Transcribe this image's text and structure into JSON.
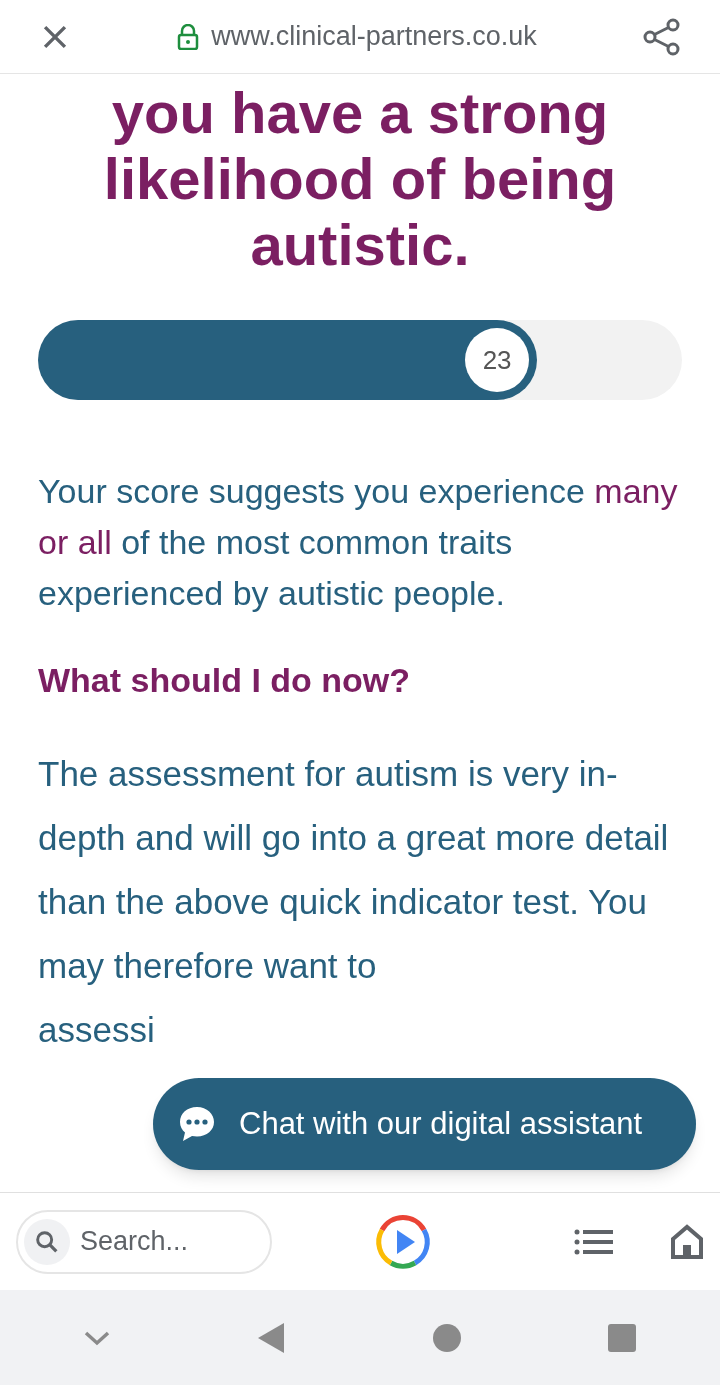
{
  "browser": {
    "url": "www.clinical-partners.co.uk"
  },
  "heading": "you have a strong likelihood of being autistic.",
  "score": {
    "value": "23",
    "level": 0.775
  },
  "summary": "Your score suggests you experience **many or all** of the most common traits experienced by autistic people.",
  "subheading": "What should I do now?",
  "paragraph": "The assessment for autism is very in-depth and will go into a great more detail than the above quick indicator test. You may therefore want to",
  "paragraph_cut": "assessi",
  "chat_button": "Chat with our digital assistant",
  "bottom_bar": {
    "search_placeholder": "Search..."
  }
}
